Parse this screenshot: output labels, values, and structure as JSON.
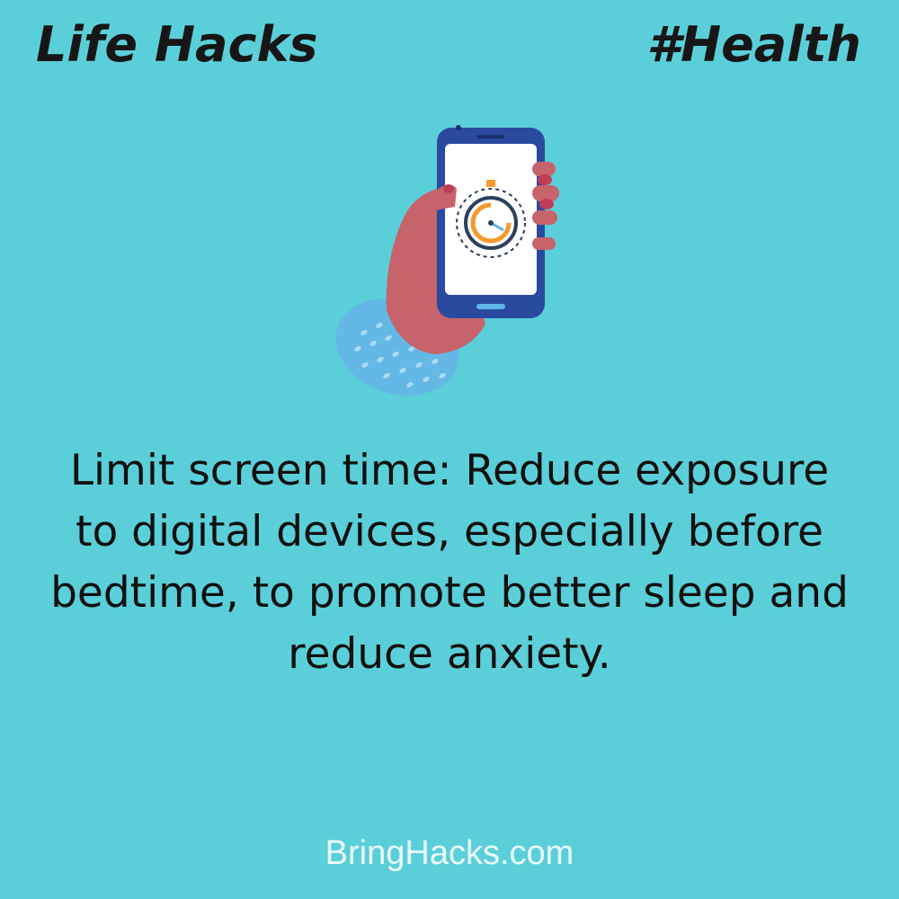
{
  "header": {
    "left_title": "Life Hacks",
    "right_tag": "#Health"
  },
  "illustration": {
    "icon": "hand-holding-phone-with-timer-icon"
  },
  "tip": {
    "text": "Limit screen time: Reduce exposure to digital devices, especially before bedtime, to promote better sleep and reduce anxiety."
  },
  "footer": {
    "site": "BringHacks.com"
  },
  "colors": {
    "background": "#5bcfd9",
    "text": "#101010",
    "footer_text": "#eafcfd",
    "phone": "#2a4aa0",
    "sleeve": "#63b8e6",
    "hand": "#c7636b",
    "timer_accent": "#f29a2e"
  }
}
